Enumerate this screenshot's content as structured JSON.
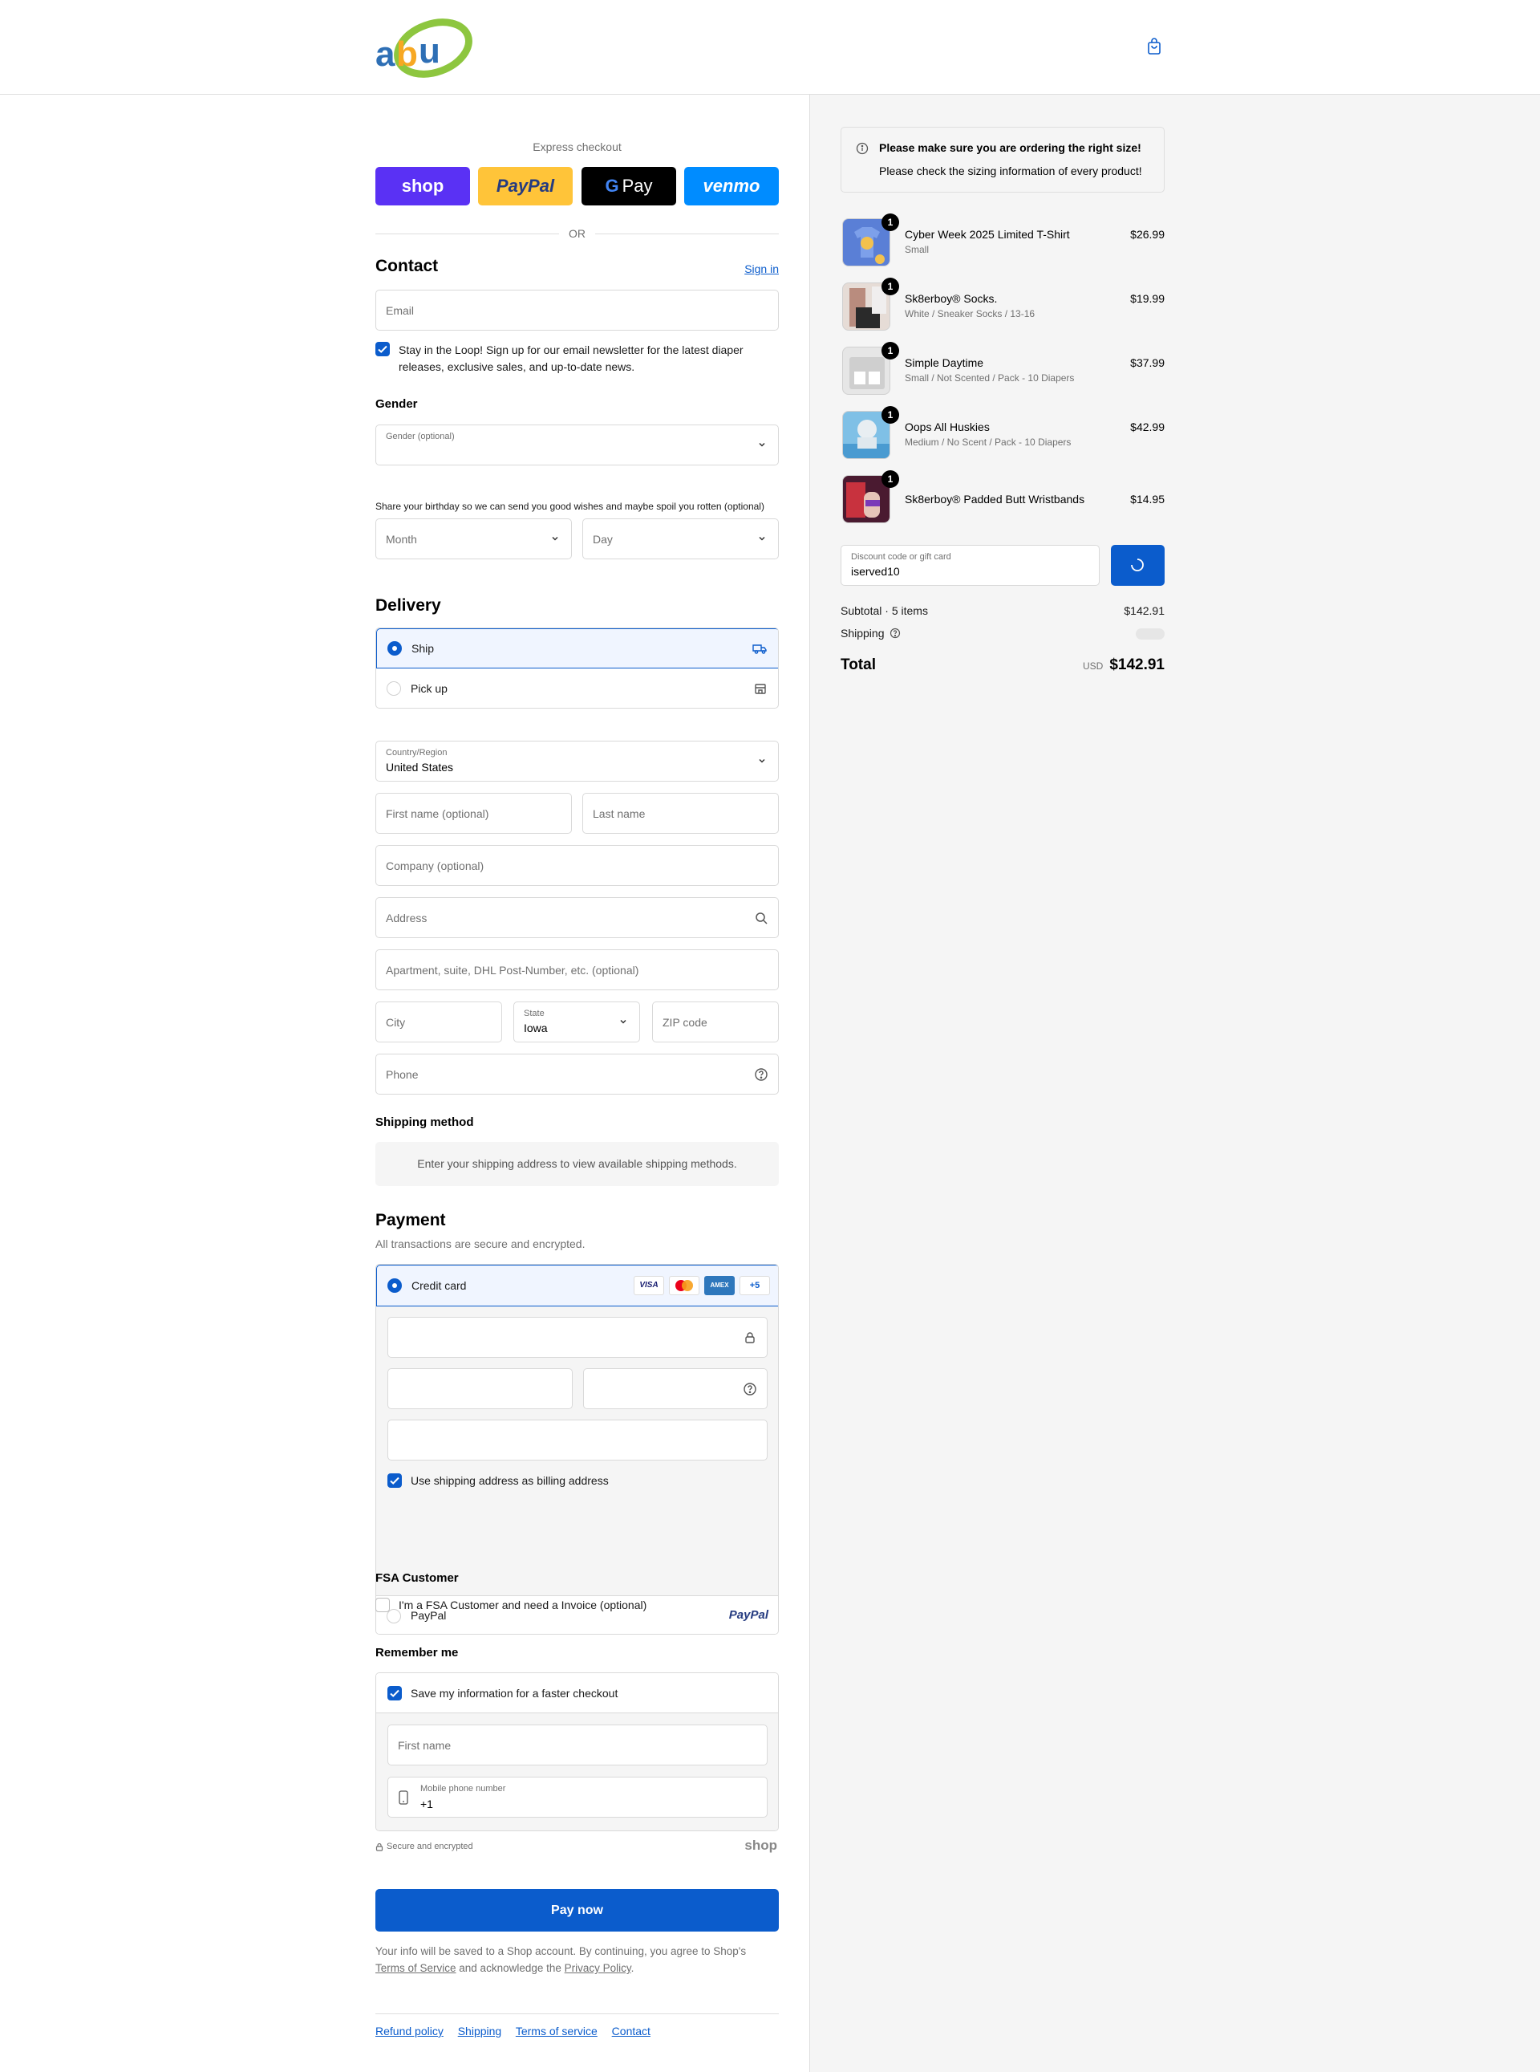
{
  "header": {
    "logo_text": "abu",
    "cart_icon": "shopping-bag-icon"
  },
  "express": {
    "label": "Express checkout",
    "shop": "shop",
    "paypal": "PayPal",
    "gpay": "Pay",
    "venmo": "venmo",
    "or": "OR"
  },
  "contact": {
    "heading": "Contact",
    "sign_in": "Sign in",
    "email_placeholder": "Email",
    "newsletter_line1": "Stay in the Loop! Sign up for our email newsletter for the latest diaper",
    "newsletter_line2": "releases, exclusive sales, and up-to-date news."
  },
  "gender": {
    "heading": "Gender",
    "label": "Gender (optional)",
    "birthday_note": "Share your birthday so we can send you good wishes and maybe spoil you rotten (optional)",
    "month_placeholder": "Month",
    "day_placeholder": "Day"
  },
  "delivery": {
    "heading": "Delivery",
    "ship": "Ship",
    "pickup": "Pick up",
    "country_label": "Country/Region",
    "country_value": "United States",
    "first_name": "First name (optional)",
    "last_name": "Last name",
    "company": "Company (optional)",
    "address": "Address",
    "apartment": "Apartment, suite, DHL Post-Number, etc. (optional)",
    "city": "City",
    "state_label": "State",
    "state_value": "Iowa",
    "zip": "ZIP code",
    "phone": "Phone"
  },
  "shipping_method": {
    "heading": "Shipping method",
    "message": "Enter your shipping address to view available shipping methods."
  },
  "payment": {
    "heading": "Payment",
    "subtitle": "All transactions are secure and encrypted.",
    "credit_card": "Credit card",
    "cards": [
      "VISA",
      "MC",
      "AMEX",
      "+5"
    ],
    "billing_same": "Use shipping address as billing address",
    "paypal": "PayPal",
    "paypal_logo": "PayPal"
  },
  "fsa": {
    "heading": "FSA Customer",
    "label": "I'm a FSA Customer and need a Invoice (optional)"
  },
  "remember": {
    "heading": "Remember me",
    "save_label": "Save my information for a faster checkout",
    "first_name": "First name",
    "mobile_label": "Mobile phone number",
    "mobile_value": "+1",
    "secure": "Secure and encrypted",
    "shop": "shop"
  },
  "pay_now": "Pay now",
  "legal": {
    "line1": "Your info will be saved to a Shop account. By continuing, you agree to Shop's",
    "tos": "Terms of Service",
    "and": " and acknowledge the ",
    "privacy": "Privacy Policy",
    "end": "."
  },
  "footer_links": [
    "Refund policy",
    "Shipping",
    "Terms of service",
    "Contact"
  ],
  "sidebar": {
    "notice_title": "Please make sure you are ordering the right size!",
    "notice_body": "Please check the sizing information of every product!",
    "items": [
      {
        "qty": "1",
        "name": "Cyber Week 2025 Limited T-Shirt",
        "variant": "Small",
        "price": "$26.99",
        "thumb_color": "#5a7fd6"
      },
      {
        "qty": "1",
        "name": "Sk8erboy® Socks.",
        "variant": "White / Sneaker Socks / 13-16",
        "price": "$19.99",
        "thumb_color": "#8a7068"
      },
      {
        "qty": "1",
        "name": "Simple Daytime",
        "variant": "Small / Not Scented / Pack - 10 Diapers",
        "price": "$37.99",
        "thumb_color": "#c8c8c8"
      },
      {
        "qty": "1",
        "name": "Oops All Huskies",
        "variant": "Medium / No Scent / Pack - 10 Diapers",
        "price": "$42.99",
        "thumb_color": "#5aa8d8"
      },
      {
        "qty": "1",
        "name": "Sk8erboy® Padded Butt Wristbands",
        "variant": "",
        "price": "$14.95",
        "thumb_color": "#6a2a4a"
      }
    ],
    "discount_label": "Discount code or gift card",
    "discount_value": "iserved10",
    "subtotal_label": "Subtotal · 5 items",
    "subtotal_value": "$142.91",
    "shipping_label": "Shipping",
    "total_label": "Total",
    "currency": "USD",
    "total_value": "$142.91"
  }
}
